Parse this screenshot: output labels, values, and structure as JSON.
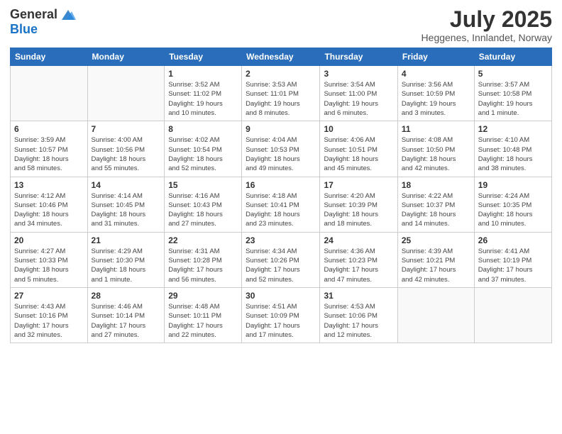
{
  "header": {
    "logo_general": "General",
    "logo_blue": "Blue",
    "main_title": "July 2025",
    "subtitle": "Heggenes, Innlandet, Norway"
  },
  "weekdays": [
    "Sunday",
    "Monday",
    "Tuesday",
    "Wednesday",
    "Thursday",
    "Friday",
    "Saturday"
  ],
  "weeks": [
    [
      {
        "day": "",
        "detail": ""
      },
      {
        "day": "",
        "detail": ""
      },
      {
        "day": "1",
        "detail": "Sunrise: 3:52 AM\nSunset: 11:02 PM\nDaylight: 19 hours\nand 10 minutes."
      },
      {
        "day": "2",
        "detail": "Sunrise: 3:53 AM\nSunset: 11:01 PM\nDaylight: 19 hours\nand 8 minutes."
      },
      {
        "day": "3",
        "detail": "Sunrise: 3:54 AM\nSunset: 11:00 PM\nDaylight: 19 hours\nand 6 minutes."
      },
      {
        "day": "4",
        "detail": "Sunrise: 3:56 AM\nSunset: 10:59 PM\nDaylight: 19 hours\nand 3 minutes."
      },
      {
        "day": "5",
        "detail": "Sunrise: 3:57 AM\nSunset: 10:58 PM\nDaylight: 19 hours\nand 1 minute."
      }
    ],
    [
      {
        "day": "6",
        "detail": "Sunrise: 3:59 AM\nSunset: 10:57 PM\nDaylight: 18 hours\nand 58 minutes."
      },
      {
        "day": "7",
        "detail": "Sunrise: 4:00 AM\nSunset: 10:56 PM\nDaylight: 18 hours\nand 55 minutes."
      },
      {
        "day": "8",
        "detail": "Sunrise: 4:02 AM\nSunset: 10:54 PM\nDaylight: 18 hours\nand 52 minutes."
      },
      {
        "day": "9",
        "detail": "Sunrise: 4:04 AM\nSunset: 10:53 PM\nDaylight: 18 hours\nand 49 minutes."
      },
      {
        "day": "10",
        "detail": "Sunrise: 4:06 AM\nSunset: 10:51 PM\nDaylight: 18 hours\nand 45 minutes."
      },
      {
        "day": "11",
        "detail": "Sunrise: 4:08 AM\nSunset: 10:50 PM\nDaylight: 18 hours\nand 42 minutes."
      },
      {
        "day": "12",
        "detail": "Sunrise: 4:10 AM\nSunset: 10:48 PM\nDaylight: 18 hours\nand 38 minutes."
      }
    ],
    [
      {
        "day": "13",
        "detail": "Sunrise: 4:12 AM\nSunset: 10:46 PM\nDaylight: 18 hours\nand 34 minutes."
      },
      {
        "day": "14",
        "detail": "Sunrise: 4:14 AM\nSunset: 10:45 PM\nDaylight: 18 hours\nand 31 minutes."
      },
      {
        "day": "15",
        "detail": "Sunrise: 4:16 AM\nSunset: 10:43 PM\nDaylight: 18 hours\nand 27 minutes."
      },
      {
        "day": "16",
        "detail": "Sunrise: 4:18 AM\nSunset: 10:41 PM\nDaylight: 18 hours\nand 23 minutes."
      },
      {
        "day": "17",
        "detail": "Sunrise: 4:20 AM\nSunset: 10:39 PM\nDaylight: 18 hours\nand 18 minutes."
      },
      {
        "day": "18",
        "detail": "Sunrise: 4:22 AM\nSunset: 10:37 PM\nDaylight: 18 hours\nand 14 minutes."
      },
      {
        "day": "19",
        "detail": "Sunrise: 4:24 AM\nSunset: 10:35 PM\nDaylight: 18 hours\nand 10 minutes."
      }
    ],
    [
      {
        "day": "20",
        "detail": "Sunrise: 4:27 AM\nSunset: 10:33 PM\nDaylight: 18 hours\nand 5 minutes."
      },
      {
        "day": "21",
        "detail": "Sunrise: 4:29 AM\nSunset: 10:30 PM\nDaylight: 18 hours\nand 1 minute."
      },
      {
        "day": "22",
        "detail": "Sunrise: 4:31 AM\nSunset: 10:28 PM\nDaylight: 17 hours\nand 56 minutes."
      },
      {
        "day": "23",
        "detail": "Sunrise: 4:34 AM\nSunset: 10:26 PM\nDaylight: 17 hours\nand 52 minutes."
      },
      {
        "day": "24",
        "detail": "Sunrise: 4:36 AM\nSunset: 10:23 PM\nDaylight: 17 hours\nand 47 minutes."
      },
      {
        "day": "25",
        "detail": "Sunrise: 4:39 AM\nSunset: 10:21 PM\nDaylight: 17 hours\nand 42 minutes."
      },
      {
        "day": "26",
        "detail": "Sunrise: 4:41 AM\nSunset: 10:19 PM\nDaylight: 17 hours\nand 37 minutes."
      }
    ],
    [
      {
        "day": "27",
        "detail": "Sunrise: 4:43 AM\nSunset: 10:16 PM\nDaylight: 17 hours\nand 32 minutes."
      },
      {
        "day": "28",
        "detail": "Sunrise: 4:46 AM\nSunset: 10:14 PM\nDaylight: 17 hours\nand 27 minutes."
      },
      {
        "day": "29",
        "detail": "Sunrise: 4:48 AM\nSunset: 10:11 PM\nDaylight: 17 hours\nand 22 minutes."
      },
      {
        "day": "30",
        "detail": "Sunrise: 4:51 AM\nSunset: 10:09 PM\nDaylight: 17 hours\nand 17 minutes."
      },
      {
        "day": "31",
        "detail": "Sunrise: 4:53 AM\nSunset: 10:06 PM\nDaylight: 17 hours\nand 12 minutes."
      },
      {
        "day": "",
        "detail": ""
      },
      {
        "day": "",
        "detail": ""
      }
    ]
  ]
}
